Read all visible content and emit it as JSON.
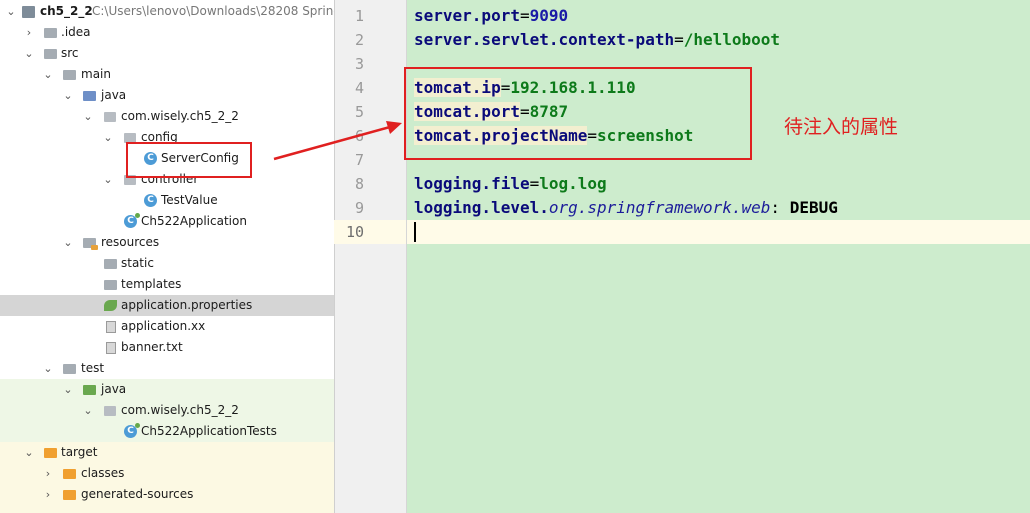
{
  "tree": {
    "root": {
      "name": "ch5_2_2",
      "path": "C:\\Users\\lenovo\\Downloads\\28208 Spring"
    },
    "items": {
      "idea": ".idea",
      "src": "src",
      "main": "main",
      "java": "java",
      "package": "com.wisely.ch5_2_2",
      "config": "config",
      "server_config": "ServerConfig",
      "controller": "controller",
      "test_value": "TestValue",
      "app": "Ch522Application",
      "resources": "resources",
      "static": "static",
      "templates": "templates",
      "app_props": "application.properties",
      "app_xx": "application.xx",
      "banner": "banner.txt",
      "test": "test",
      "test_java": "java",
      "test_package": "com.wisely.ch5_2_2",
      "app_tests": "Ch522ApplicationTests",
      "target": "target",
      "classes": "classes",
      "generated_sources": "generated-sources"
    }
  },
  "editor": {
    "line_numbers": [
      "1",
      "2",
      "3",
      "4",
      "5",
      "6",
      "7",
      "8",
      "9",
      "10"
    ],
    "lines": {
      "l1_key": "server.port",
      "l1_eq": "=",
      "l1_val": "9090",
      "l2_key": "server.servlet.context-path",
      "l2_eq": "=",
      "l2_val": "/helloboot",
      "l4_key": "tomcat.ip",
      "l4_eq": "=",
      "l4_val": "192.168.1.110",
      "l5_key": "tomcat.port",
      "l5_eq": "=",
      "l5_val": "8787",
      "l6_key": "tomcat.projectName",
      "l6_eq": "=",
      "l6_val": "screenshot",
      "l8_key": "logging.file",
      "l8_eq": "=",
      "l8_val": "log.log",
      "l9_key": "logging.level.",
      "l9_italic": "org.springframework.web",
      "l9_sep": ": ",
      "l9_val": "DEBUG"
    }
  },
  "annotation": "待注入的属性",
  "colors": {
    "editor_bg": "#cdeccd",
    "annotation": "#e02020",
    "key": "#0a0a7a",
    "value": "#0d7a1a"
  }
}
